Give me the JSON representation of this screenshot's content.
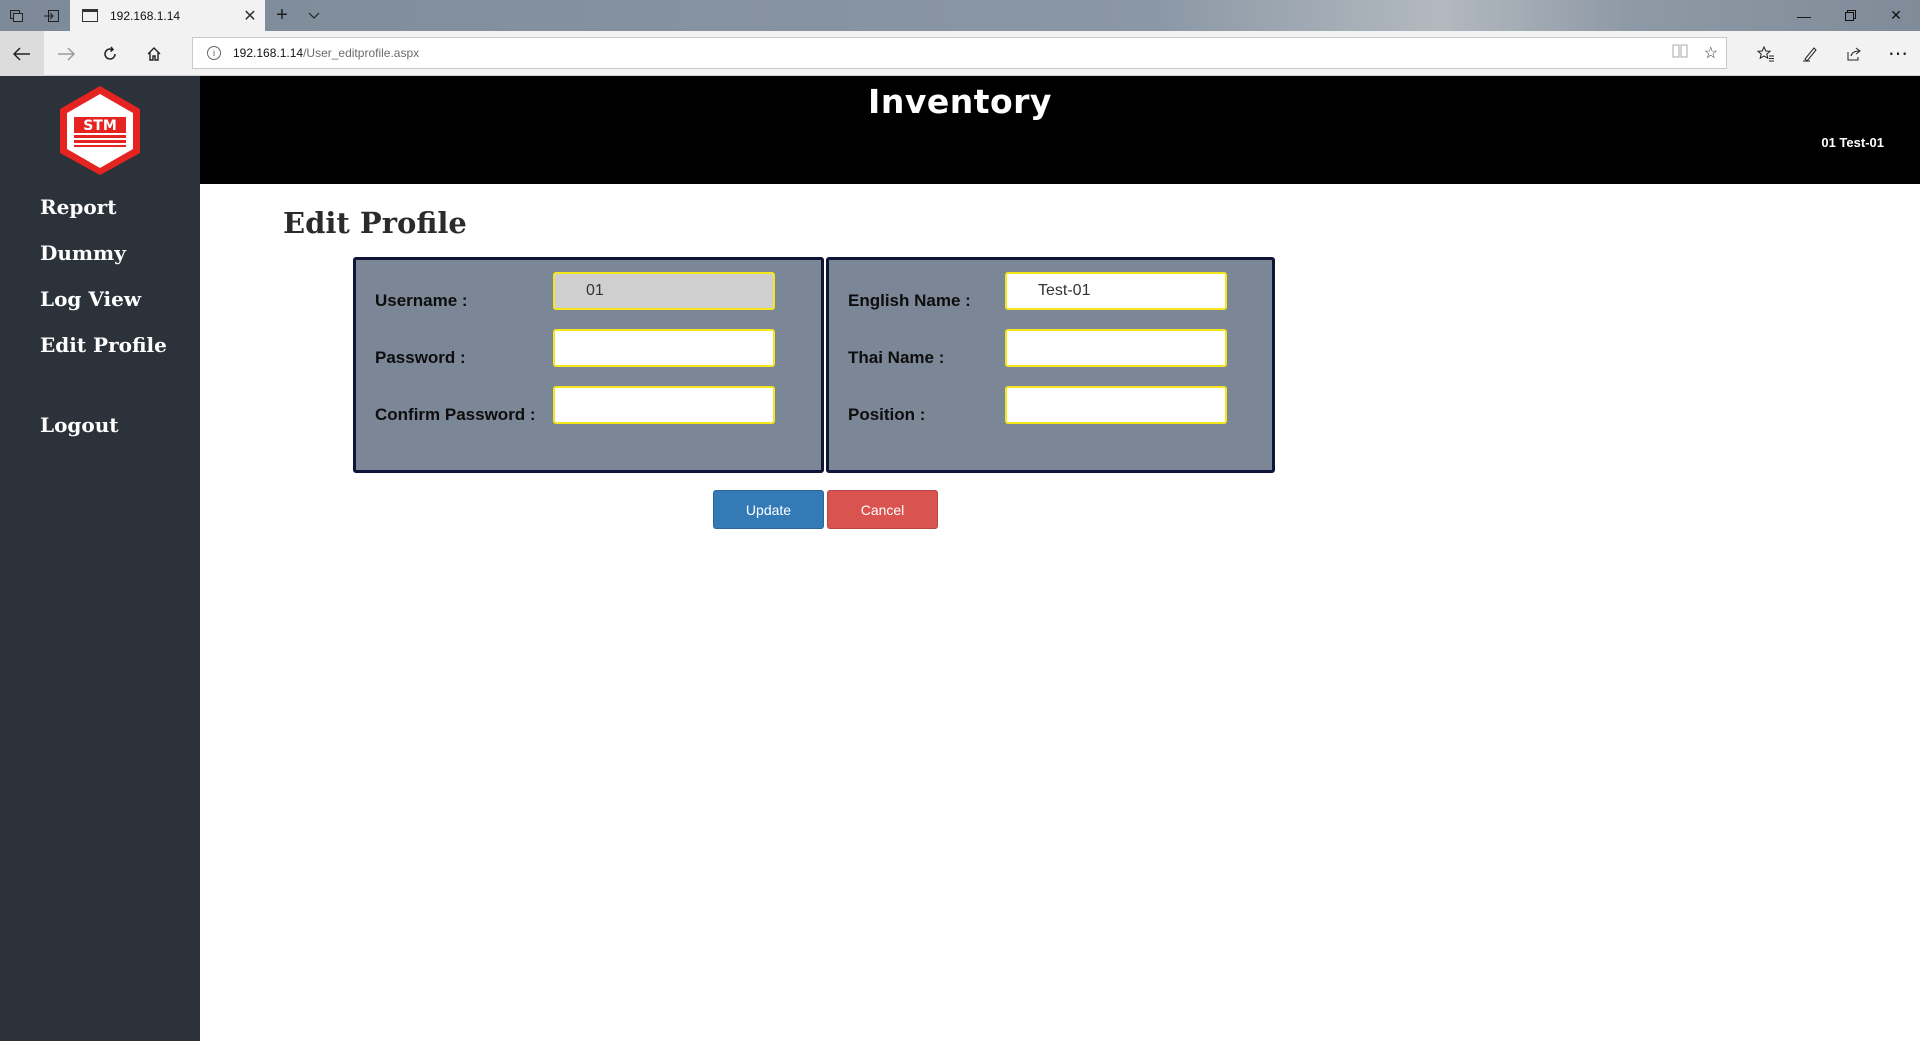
{
  "browser": {
    "tab_title": "192.168.1.14",
    "url_host": "192.168.1.14",
    "url_path": "/User_editprofile.aspx",
    "icons": {
      "tab_manager": "tab-manager-icon",
      "set_aside": "set-aside-icon",
      "tab_favicon": "page-icon",
      "tab_close": "close-icon",
      "new_tab": "plus-icon",
      "tab_list": "chevron-down-icon",
      "minimize": "minimize-icon",
      "restore": "restore-icon",
      "close_window": "close-icon",
      "back": "arrow-left-icon",
      "forward": "arrow-right-icon",
      "refresh": "refresh-icon",
      "home": "home-icon",
      "info": "info-icon",
      "reading_view": "reading-view-icon",
      "favorite": "star-icon",
      "favorites_hub": "favorites-hub-icon",
      "notes": "pen-icon",
      "share": "share-icon",
      "more": "more-icon"
    }
  },
  "app": {
    "title": "Inventory",
    "user": "01 Test-01",
    "logo_text": "STM"
  },
  "sidebar": {
    "items": [
      {
        "label": "Report"
      },
      {
        "label": "Dummy"
      },
      {
        "label": "Log View"
      },
      {
        "label": "Edit Profile"
      },
      {
        "label": "Logout"
      }
    ]
  },
  "main": {
    "title": "Edit Profile",
    "left_fields": [
      {
        "label": "Username :",
        "value": "01",
        "readonly": true
      },
      {
        "label": "Password :",
        "value": ""
      },
      {
        "label": "Confirm Password :",
        "value": ""
      }
    ],
    "right_fields": [
      {
        "label": "English Name :",
        "value": "Test-01"
      },
      {
        "label": "Thai Name :",
        "value": ""
      },
      {
        "label": "Position :",
        "value": ""
      }
    ],
    "update_label": "Update",
    "cancel_label": "Cancel"
  },
  "colors": {
    "sidebar": "#2b323a",
    "header": "#000000",
    "panel": "#7b8796",
    "panel_border": "#0e1538",
    "input_border": "#f5e51c",
    "update": "#337ab7",
    "cancel": "#d9534f"
  }
}
